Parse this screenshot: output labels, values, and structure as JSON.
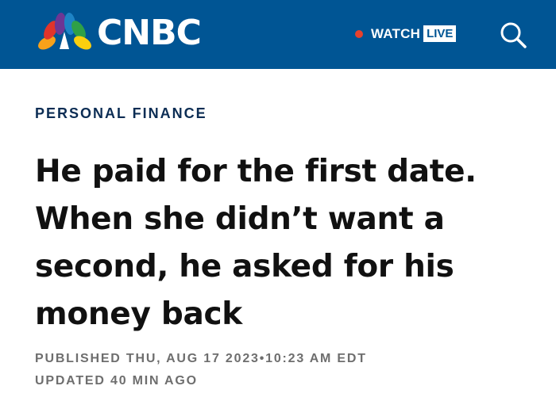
{
  "header": {
    "brand": "CNBC",
    "watch_label": "WATCH",
    "live_label": "LIVE",
    "bg_color": "#005594",
    "live_dot_color": "#e8412c"
  },
  "article": {
    "section": "PERSONAL FINANCE",
    "headline": "He paid for the first date. When she didn’t want a second, he asked for his money back",
    "published": "PUBLISHED THU, AUG 17 2023•10:23 AM EDT",
    "updated": "UPDATED 40 MIN AGO"
  },
  "icons": [
    "peacock-logo-icon",
    "live-dot-icon",
    "search-icon"
  ]
}
